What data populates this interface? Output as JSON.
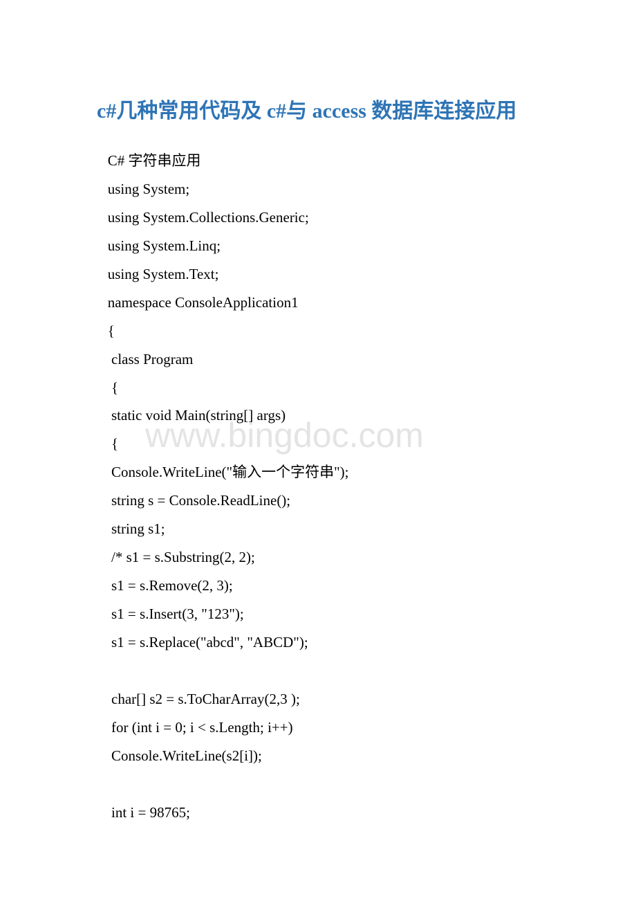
{
  "title": "c#几种常用代码及 c#与 access 数据库连接应用",
  "watermark": "www.bingdoc.com",
  "lines": [
    "   C# 字符串应用",
    "   using System;",
    "   using System.Collections.Generic;",
    "   using System.Linq;",
    "   using System.Text;",
    "   namespace ConsoleApplication1",
    "   {",
    "    class Program",
    "    {",
    "    static void Main(string[] args)",
    "    {",
    "    Console.WriteLine(\"输入一个字符串\");",
    "    string s = Console.ReadLine();",
    "    string s1;",
    "    /* s1 = s.Substring(2, 2);",
    "    s1 = s.Remove(2, 3);",
    "    s1 = s.Insert(3, \"123\");",
    "    s1 = s.Replace(\"abcd\", \"ABCD\");",
    "     ",
    "    char[] s2 = s.ToCharArray(2,3 );",
    "    for (int i = 0; i < s.Length; i++)",
    "    Console.WriteLine(s2[i]);",
    "     ",
    "    int i = 98765;"
  ]
}
